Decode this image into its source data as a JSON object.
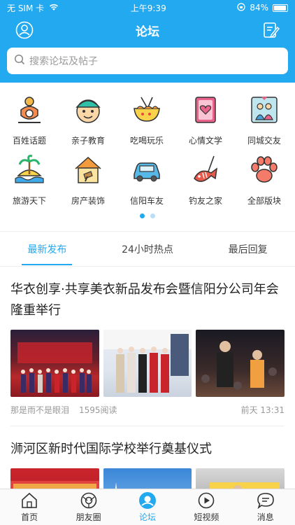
{
  "status": {
    "carrier": "无 SIM 卡",
    "time": "上午9:39",
    "battery": "84%"
  },
  "nav": {
    "title": "论坛"
  },
  "search": {
    "placeholder": "搜索论坛及帖子"
  },
  "categories": [
    {
      "label": "百姓话题",
      "icon": "people-topic-icon"
    },
    {
      "label": "亲子教育",
      "icon": "child-face-icon"
    },
    {
      "label": "吃喝玩乐",
      "icon": "noodle-bowl-icon"
    },
    {
      "label": "心情文学",
      "icon": "heart-book-icon"
    },
    {
      "label": "同城交友",
      "icon": "couple-frame-icon"
    },
    {
      "label": "旅游天下",
      "icon": "island-icon"
    },
    {
      "label": "房产装饰",
      "icon": "house-icon"
    },
    {
      "label": "信阳车友",
      "icon": "car-icon"
    },
    {
      "label": "钓友之家",
      "icon": "fish-icon"
    },
    {
      "label": "全部版块",
      "icon": "paw-icon"
    }
  ],
  "tabs": [
    {
      "label": "最新发布",
      "active": true
    },
    {
      "label": "24小时热点",
      "active": false
    },
    {
      "label": "最后回复",
      "active": false
    }
  ],
  "posts": [
    {
      "title": "华衣创享·共享美衣新品发布会暨信阳分公司年会隆重举行",
      "author": "那是雨不是眼泪",
      "reads": "1595阅读",
      "time": "前天 13:31"
    },
    {
      "title": "浉河区新时代国际学校举行奠基仪式",
      "author": "",
      "reads": "",
      "time": ""
    }
  ],
  "tabbar": [
    {
      "label": "首页",
      "icon": "home-icon"
    },
    {
      "label": "朋友圈",
      "icon": "friends-icon"
    },
    {
      "label": "论坛",
      "icon": "forum-icon"
    },
    {
      "label": "短视频",
      "icon": "video-icon"
    },
    {
      "label": "消息",
      "icon": "message-icon"
    }
  ],
  "colors": {
    "accent": "#22a9f0"
  }
}
